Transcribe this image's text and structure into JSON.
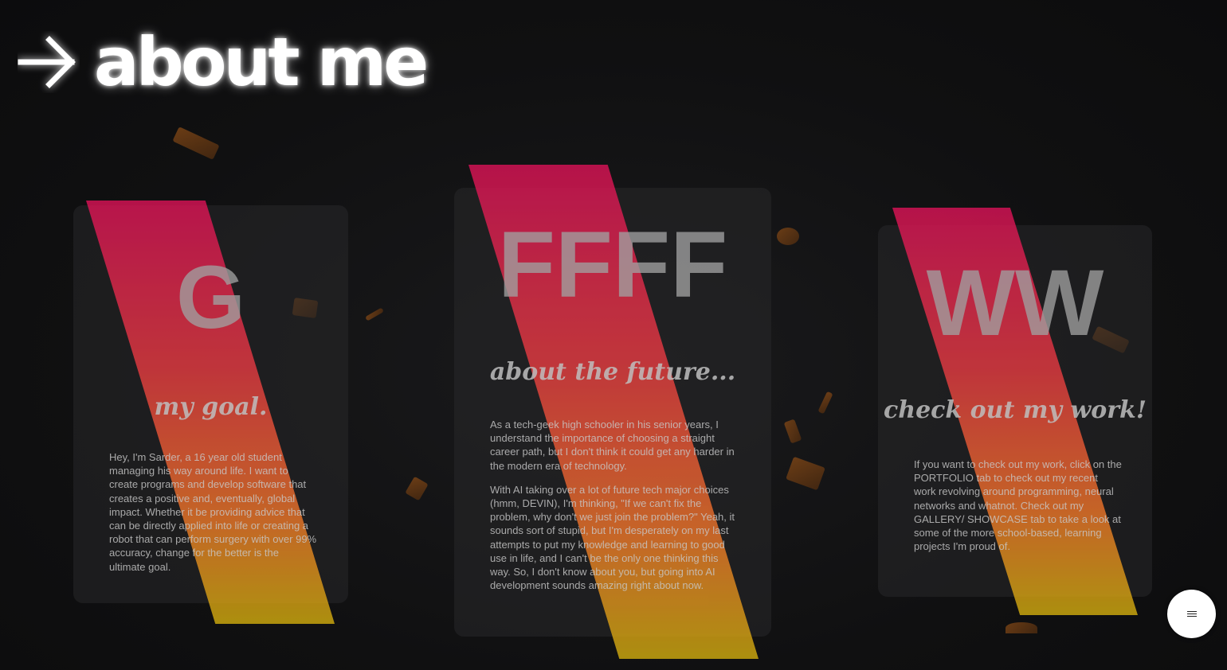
{
  "header": {
    "title": "about me",
    "arrow_icon": "arrow-right-icon"
  },
  "cards": [
    {
      "letter": "G",
      "subtitle": "my goal.",
      "paragraphs": [
        "Hey, I'm Sarder, a 16 year old student managing his way around life. I want to create programs and develop software that creates a positive and, eventually, global impact. Whether it be providing advice that can be directly applied into life or creating a robot that can perform surgery with over 99% accuracy, change for the better is the ultimate goal."
      ]
    },
    {
      "letter": "FFFF",
      "subtitle": "about the future...",
      "paragraphs": [
        "As a tech-geek high schooler in his senior years, I understand the importance of choosing a straight career path, but I don't think it could get any harder in the modern era of technology.",
        "With AI taking over a lot of future tech major choices (hmm, DEVIN), I'm thinking, \"If we can't fix the problem, why don't we just join the problem?\" Yeah, it sounds sort of stupid, but I'm desperately on my last attempts to put my knowledge and learning to good use in life, and I can't be the only one thinking this way. So, I don't know about you, but going into AI development sounds amazing right about now."
      ]
    },
    {
      "letter": "WW",
      "subtitle": "check out my work!",
      "paragraphs": [
        "If you want to check out my work, click on the PORTFOLIO tab to check out my recent work revolving around programming, neural networks and whatnot. Check out my GALLERY/ SHOWCASE tab to take a look at some of the more school-based, learning projects I'm proud of."
      ]
    }
  ],
  "menu": {
    "icon": "menu-icon"
  },
  "colors": {
    "background": "#0f0f10",
    "stripe_top": "#e3135a",
    "stripe_mid": "#f57a2a",
    "stripe_bottom": "#d9b40f",
    "title": "#ffffff"
  }
}
